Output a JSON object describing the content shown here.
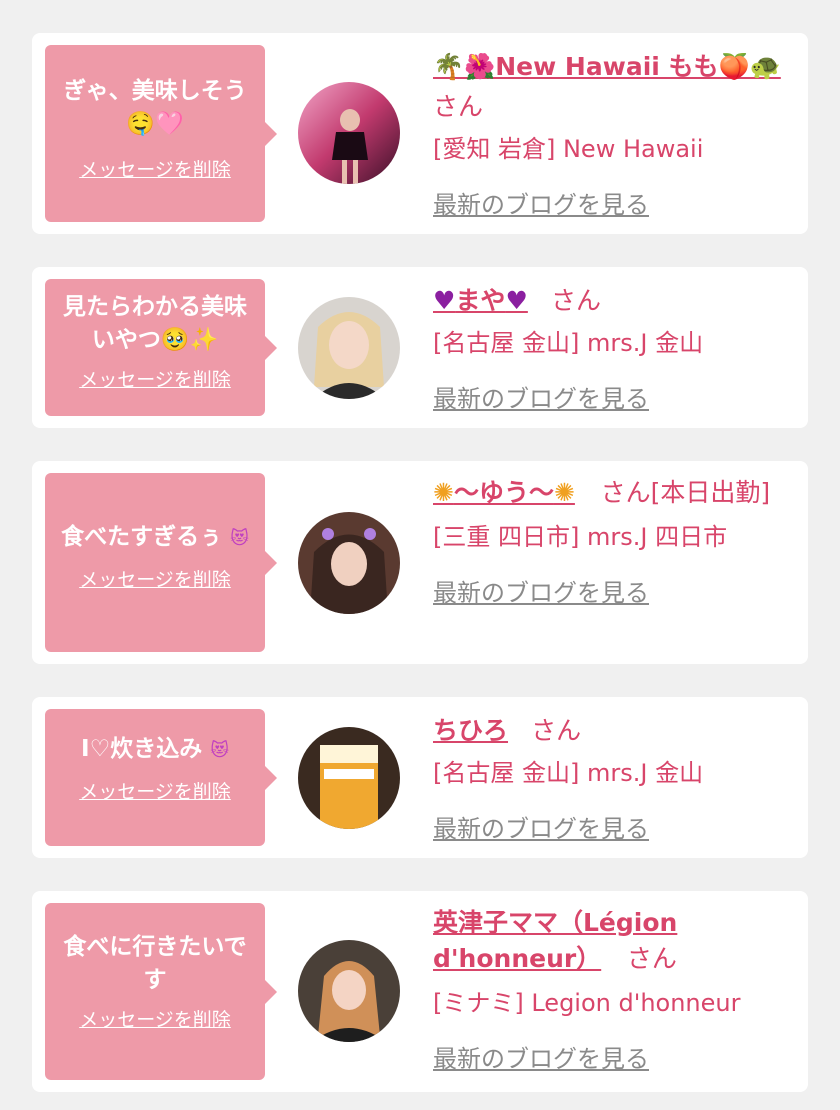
{
  "common": {
    "delete_label": "メッセージを削除",
    "blog_label": "最新のブログを見る",
    "san": "さん"
  },
  "colors": {
    "bubble": "#ee9aa8",
    "accent": "#d8456a",
    "link_gray": "#8a8a8a",
    "card_bg": "#ffffff",
    "page_bg": "#f0f0f0"
  },
  "cards": [
    {
      "message": "ぎゃ、美味しそう🤤🩷",
      "name": "🌴🌺New Hawaii もも🍑🐢",
      "suffix": "さん",
      "location": "[愛知 岩倉] New Hawaii",
      "avatar_icon": "avatar-photo-icon"
    },
    {
      "message": "見たらわかる美味いやつ🥹✨",
      "name_core": "まや",
      "suffix": "さん",
      "location": "[名古屋 金山] mrs.J 金山",
      "avatar_icon": "avatar-photo-icon"
    },
    {
      "message": "食べたすぎるぅ",
      "name_core": "〜ゆう〜",
      "suffix": "さん[本日出勤]",
      "location": "[三重 四日市] mrs.J 四日市",
      "avatar_icon": "avatar-photo-icon"
    },
    {
      "message": "I♡炊き込み",
      "name": "ちひろ",
      "suffix": "さん",
      "location": "[名古屋 金山] mrs.J 金山",
      "avatar_icon": "avatar-photo-icon"
    },
    {
      "message": "食べに行きたいです",
      "name": "英津子ママ（Légion d'honneur）",
      "suffix": "さん",
      "location": "[ミナミ] Legion d'honneur",
      "avatar_icon": "avatar-photo-icon"
    }
  ]
}
